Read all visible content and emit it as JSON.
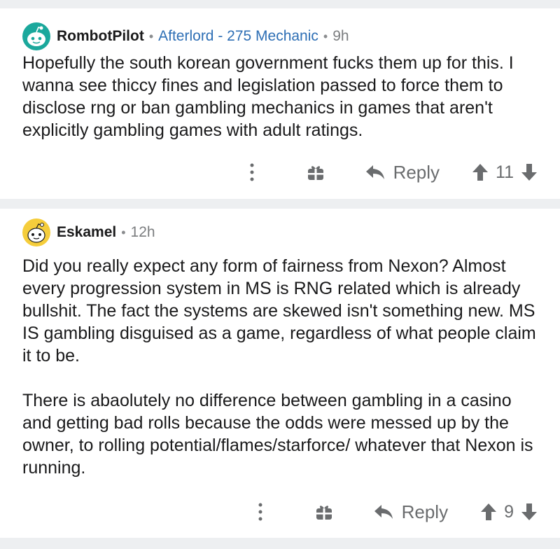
{
  "comments": [
    {
      "username": "RombotPilot",
      "flair": "Afterlord - 275 Mechanic",
      "age": "9h",
      "avatar_icon": "reddit-snoo-avatar-teal",
      "paragraphs": [
        "Hopefully the south korean government fucks them up for this. I wanna see thiccy fines and legislation passed to force them to disclose rng or ban gambling mechanics in games that aren't explicitly gambling games with adult ratings."
      ],
      "reply_label": "Reply",
      "score": "11"
    },
    {
      "username": "Eskamel",
      "age": "12h",
      "avatar_icon": "reddit-snoo-avatar-yellow",
      "paragraphs": [
        "Did you really expect any form of fairness from Nexon? Almost every progression system in MS is RNG related which is already bullshit. The fact the systems are skewed isn't something new. MS IS gambling disguised as a game, regardless of what people claim it to be.",
        "There is abaolutely no difference between gambling in a casino and getting bad rolls because the odds were messed up by the owner, to rolling potential/flames/starforce/ whatever that Nexon is running."
      ],
      "reply_label": "Reply",
      "score": "9"
    }
  ],
  "colors": {
    "background": "#edeff1",
    "card": "#ffffff",
    "flair": "#2e6fb5",
    "meta": "#7c7e80",
    "action": "#6a6c6e"
  }
}
